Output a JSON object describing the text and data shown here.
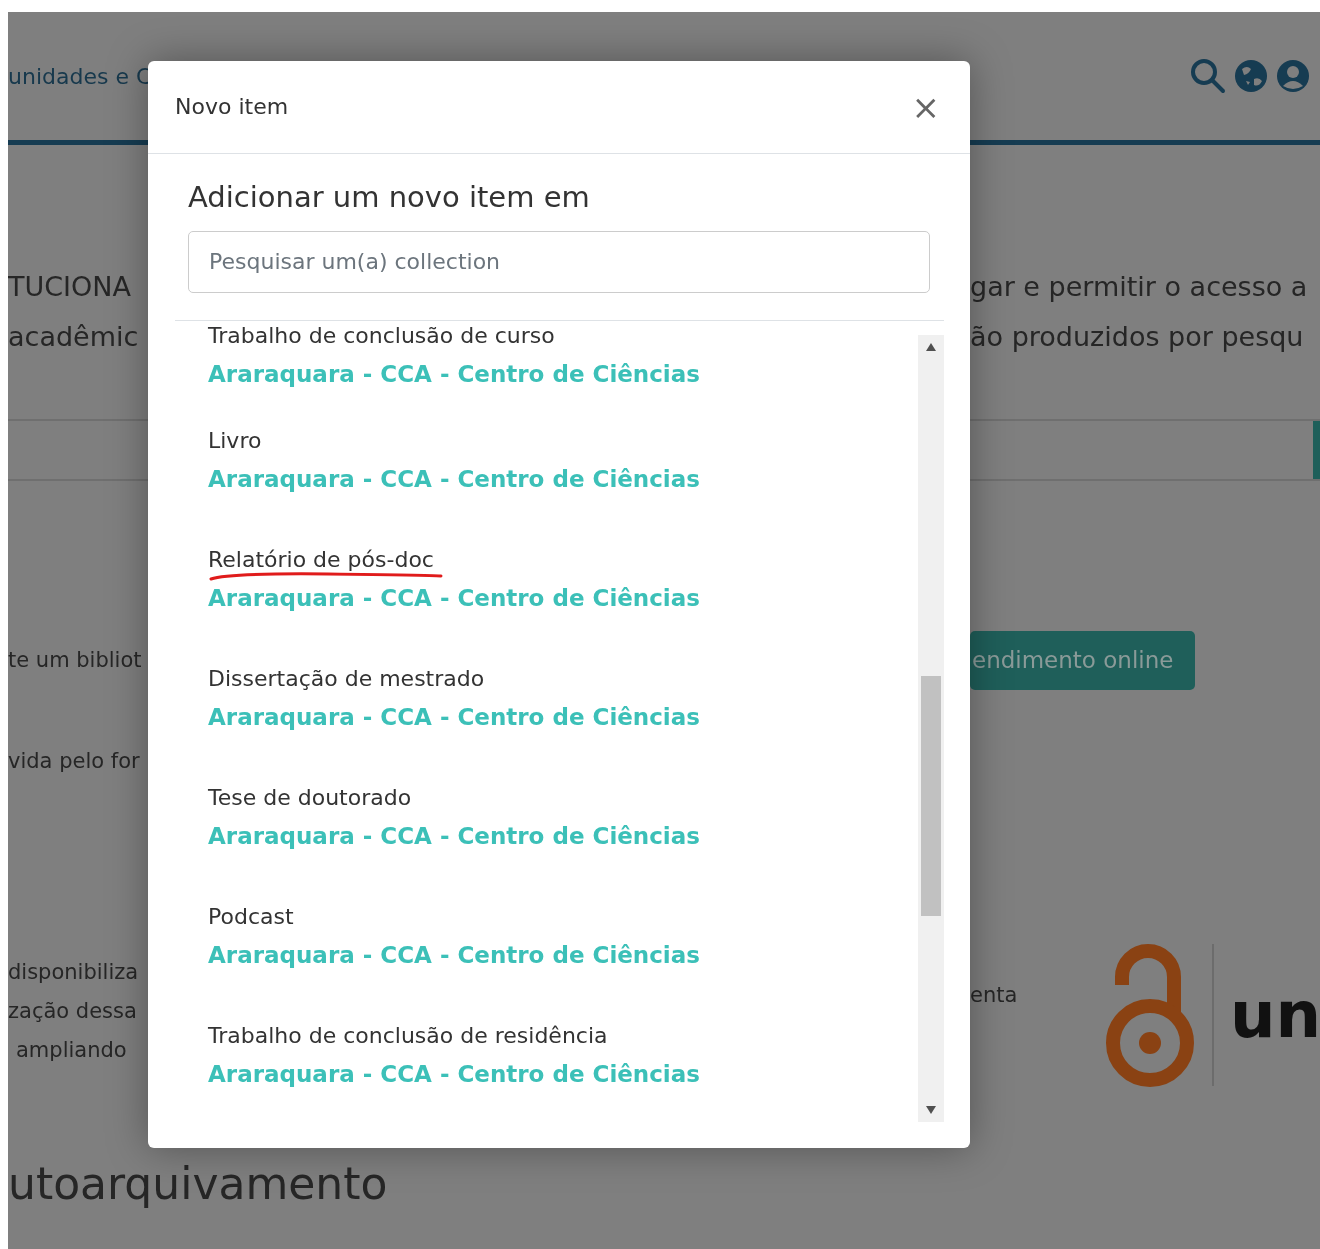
{
  "page": {
    "nav_text": "unidades e C",
    "hero": [
      {
        "left": "TUCIONA",
        "right": "gar e permitir o acesso a"
      },
      {
        "left": "acadêmic",
        "right": "ão produzidos por pesqu"
      }
    ],
    "help_left": [
      "te um bibliot",
      "vida pelo for"
    ],
    "help_button": "endimento online",
    "about_left": [
      "disponibiliza",
      "zação dessa",
      "ampliando"
    ],
    "about_right": "enta",
    "logo_text": "un",
    "bottom_heading": "utoarquivamento"
  },
  "modal": {
    "title": "Novo item",
    "close": "×",
    "heading": "Adicionar um novo item em",
    "search": {
      "placeholder": "Pesquisar um(a) collection"
    },
    "collections": [
      {
        "name": "Trabalho de conclusão de curso",
        "community": "Araraquara - CCA - Centro de Ciências",
        "marked": false
      },
      {
        "name": "Livro",
        "community": "Araraquara - CCA - Centro de Ciências",
        "marked": false
      },
      {
        "name": "Relatório de pós-doc",
        "community": "Araraquara - CCA - Centro de Ciências",
        "marked": true
      },
      {
        "name": "Dissertação de mestrado",
        "community": "Araraquara - CCA - Centro de Ciências",
        "marked": false
      },
      {
        "name": "Tese de doutorado",
        "community": "Araraquara - CCA - Centro de Ciências",
        "marked": false
      },
      {
        "name": "Podcast",
        "community": "Araraquara - CCA - Centro de Ciências",
        "marked": false
      },
      {
        "name": "Trabalho de conclusão de residência",
        "community": "Araraquara - CCA - Centro de Ciências",
        "marked": false
      }
    ]
  }
}
